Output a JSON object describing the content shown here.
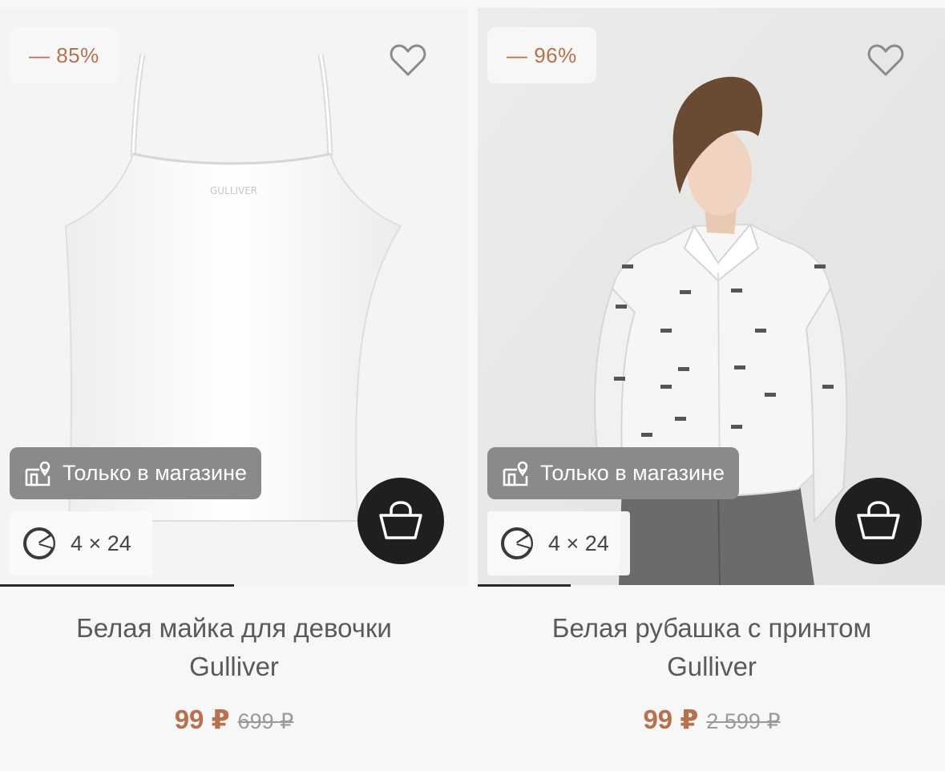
{
  "products": [
    {
      "discount": "— 85%",
      "store_badge": "Только в магазине",
      "installment": "4 × 24",
      "title_line1": "Белая майка для девочки",
      "title_line2": "Gulliver",
      "price_current": "99 ₽",
      "price_old": "699 ₽",
      "garment_logo": "GULLIVER",
      "progress": 0.5
    },
    {
      "discount": "— 96%",
      "store_badge": "Только в магазине",
      "installment": "4 × 24",
      "title_line1": "Белая рубашка с принтом",
      "title_line2": "Gulliver",
      "price_current": "99 ₽",
      "price_old": "2 599 ₽",
      "progress": 0.2
    }
  ],
  "icons": {
    "favorite": "heart-outline-icon",
    "cart": "shopping-basket-icon",
    "store": "store-pin-icon",
    "installment": "installment-pie-icon"
  },
  "colors": {
    "accent": "#b8714f",
    "cart_bg": "#1f1f1f",
    "badge_bg": "#8a8a8a",
    "text": "#5a5a5a"
  }
}
